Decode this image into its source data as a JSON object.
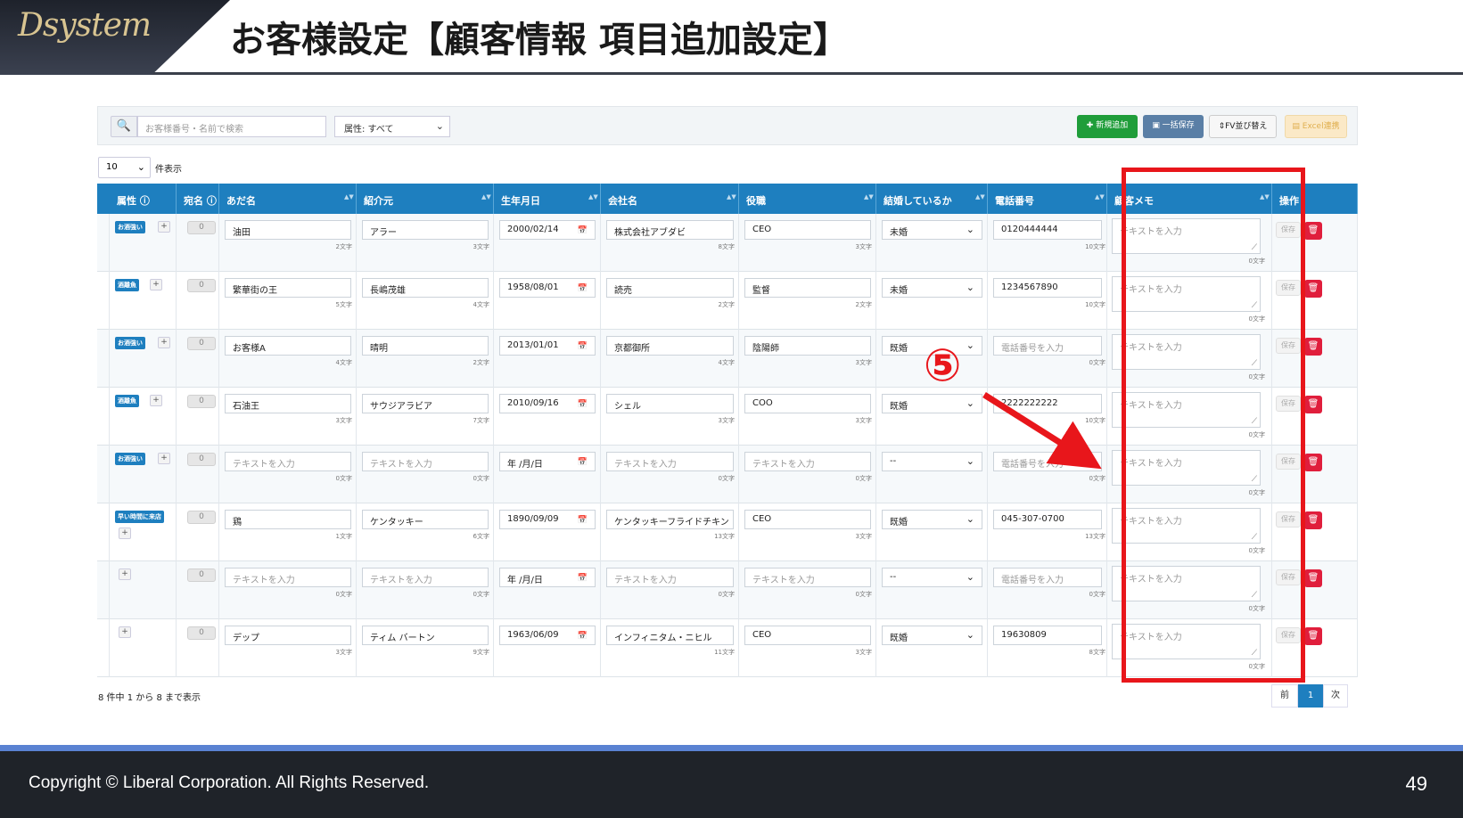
{
  "slide": {
    "logo_text": "Dsystem",
    "title": "お客様設定【顧客情報 項目追加設定】",
    "copyright": "Copyright ©  Liberal Corporation. All Rights Reserved.",
    "page_number": "49",
    "annotation_number": "⑤"
  },
  "toolbar": {
    "search_placeholder": "お客様番号・名前で検索",
    "attr_select": "属性: すべて",
    "btn_new": "✚ 新規追加",
    "btn_bulk_save": "▣ 一括保存",
    "btn_fv_sort": "⇕FV並び替え",
    "btn_excel": "▤ Excel連携"
  },
  "entries": {
    "value": "10",
    "label": "件表示"
  },
  "columns": [
    "属性 ⓘ",
    "宛名 ⓘ",
    "あだ名",
    "紹介元",
    "生年月日",
    "会社名",
    "役職",
    "結婚しているか",
    "電話番号",
    "顧客メモ",
    "操作"
  ],
  "rows": [
    {
      "badges": [
        "お酒強い"
      ],
      "nickname": "油田",
      "nickname_count": "2文字",
      "referrer": "アラー",
      "referrer_count": "3文字",
      "birthday": "2000/02/14",
      "company": "株式会社アブダビ",
      "company_count": "8文字",
      "position": "CEO",
      "position_count": "3文字",
      "married": "未婚",
      "phone": "0120444444",
      "phone_count": "10文字",
      "memo_placeholder": "テキストを入力",
      "memo_count": "0文字"
    },
    {
      "badges": [
        "酒離魚"
      ],
      "nickname": "繁華街の王",
      "nickname_count": "5文字",
      "referrer": "長嶋茂雄",
      "referrer_count": "4文字",
      "birthday": "1958/08/01",
      "company": "読売",
      "company_count": "2文字",
      "position": "監督",
      "position_count": "2文字",
      "married": "未婚",
      "phone": "1234567890",
      "phone_count": "10文字",
      "memo_placeholder": "テキストを入力",
      "memo_count": "0文字"
    },
    {
      "badges": [
        "お酒強い"
      ],
      "nickname": "お客様A",
      "nickname_count": "4文字",
      "referrer": "晴明",
      "referrer_count": "2文字",
      "birthday": "2013/01/01",
      "company": "京都御所",
      "company_count": "4文字",
      "position": "陰陽師",
      "position_count": "3文字",
      "married": "既婚",
      "phone": "電話番号を入力",
      "phone_count": "0文字",
      "memo_placeholder": "テキストを入力",
      "memo_count": "0文字"
    },
    {
      "badges": [
        "酒離魚"
      ],
      "nickname": "石油王",
      "nickname_count": "3文字",
      "referrer": "サウジアラビア",
      "referrer_count": "7文字",
      "birthday": "2010/09/16",
      "company": "シェル",
      "company_count": "3文字",
      "position": "COO",
      "position_count": "3文字",
      "married": "既婚",
      "phone": "2222222222",
      "phone_count": "10文字",
      "memo_placeholder": "テキストを入力",
      "memo_count": "0文字"
    },
    {
      "badges": [
        "お酒強い"
      ],
      "nickname": "テキストを入力",
      "nickname_count": "0文字",
      "referrer": "テキストを入力",
      "referrer_count": "0文字",
      "birthday": "年 /月/日",
      "company": "テキストを入力",
      "company_count": "0文字",
      "position": "テキストを入力",
      "position_count": "0文字",
      "married": "--",
      "phone": "電話番号を入力",
      "phone_count": "0文字",
      "memo_placeholder": "テキストを入力",
      "memo_count": "0文字"
    },
    {
      "badges": [
        "早い時間に来店"
      ],
      "nickname": "鶏",
      "nickname_count": "1文字",
      "referrer": "ケンタッキー",
      "referrer_count": "6文字",
      "birthday": "1890/09/09",
      "company": "ケンタッキーフライドチキン",
      "company_count": "13文字",
      "position": "CEO",
      "position_count": "3文字",
      "married": "既婚",
      "phone": "045-307-0700",
      "phone_count": "13文字",
      "memo_placeholder": "テキストを入力",
      "memo_count": "0文字"
    },
    {
      "badges": [],
      "nickname": "テキストを入力",
      "nickname_count": "0文字",
      "referrer": "テキストを入力",
      "referrer_count": "0文字",
      "birthday": "年 /月/日",
      "company": "テキストを入力",
      "company_count": "0文字",
      "position": "テキストを入力",
      "position_count": "0文字",
      "married": "--",
      "phone": "電話番号を入力",
      "phone_count": "0文字",
      "memo_placeholder": "テキストを入力",
      "memo_count": "0文字"
    },
    {
      "badges": [],
      "nickname": "デップ",
      "nickname_count": "3文字",
      "referrer": "ティム バートン",
      "referrer_count": "9文字",
      "birthday": "1963/06/09",
      "company": "インフィニタム・ニヒル",
      "company_count": "11文字",
      "position": "CEO",
      "position_count": "3文字",
      "married": "既婚",
      "phone": "19630809",
      "phone_count": "8文字",
      "memo_placeholder": "テキストを入力",
      "memo_count": "0文字"
    }
  ],
  "row_controls": {
    "zero": "0",
    "plus": "+",
    "save": "保存",
    "delete_icon": "trash-icon"
  },
  "footer_info": "8 件中 1 から 8 まで表示",
  "pagination": {
    "prev": "前",
    "current": "1",
    "next": "次"
  },
  "colors": {
    "header_blue": "#1e7fbf",
    "highlight_red": "#e8161b",
    "add_green": "#1f9d3a",
    "delete_red": "#e01e3c"
  }
}
